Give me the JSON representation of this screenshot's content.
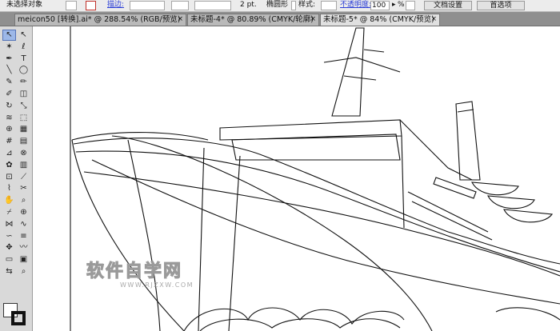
{
  "control_bar": {
    "selection_status": "未选择对象",
    "stroke_label": "描边:",
    "stroke_weight": "2 pt.",
    "brush_label": "椭圆形",
    "style_label": "样式:",
    "opacity_label": "不透明度:",
    "opacity_value": "100",
    "percent_symbol": "%",
    "doc_setup_button": "文档设置",
    "preferences_button": "首选项"
  },
  "tabs": [
    {
      "label": "meicon50 [转换].ai* @ 288.54% (RGB/预览)",
      "close": "×",
      "active": false
    },
    {
      "label": "未标题-4* @ 80.89% (CMYK/轮廓)",
      "close": "×",
      "active": false
    },
    {
      "label": "未标题-5* @ 84% (CMYK/预览)",
      "close": "×",
      "active": true
    }
  ],
  "watermark": {
    "title": "软件自学网",
    "url": "WWW.RJZXW.COM"
  },
  "tools": [
    [
      "selection-tool",
      "↖"
    ],
    [
      "direct-selection-tool",
      "↖"
    ],
    [
      "magic-wand-tool",
      "✶"
    ],
    [
      "lasso-tool",
      "ℓ"
    ],
    [
      "pen-tool",
      "✒"
    ],
    [
      "type-tool",
      "T"
    ],
    [
      "line-tool",
      "╲"
    ],
    [
      "ellipse-tool",
      "◯"
    ],
    [
      "paintbrush-tool",
      "✎"
    ],
    [
      "pencil-tool",
      "✏"
    ],
    [
      "blob-brush-tool",
      "✐"
    ],
    [
      "eraser-tool",
      "◫"
    ],
    [
      "rotate-tool",
      "↻"
    ],
    [
      "scale-tool",
      "⤡"
    ],
    [
      "warp-tool",
      "≋"
    ],
    [
      "free-transform-tool",
      "⬚"
    ],
    [
      "shape-builder-tool",
      "⊕"
    ],
    [
      "perspective-grid-tool",
      "▦"
    ],
    [
      "mesh-tool",
      "#"
    ],
    [
      "gradient-tool",
      "▤"
    ],
    [
      "eyedropper-tool",
      "⊿"
    ],
    [
      "blend-tool",
      "⊗"
    ],
    [
      "symbol-sprayer-tool",
      "✿"
    ],
    [
      "column-graph-tool",
      "▥"
    ],
    [
      "artboard-tool",
      "⊡"
    ],
    [
      "slice-tool",
      "⟋"
    ],
    [
      "width-tool",
      "⌇"
    ],
    [
      "scissors-tool",
      "✂"
    ],
    [
      "hand-tool",
      "✋"
    ],
    [
      "zoom-tool",
      "⌕"
    ],
    [
      "knife-tool",
      "⌿"
    ],
    [
      "crosshair-tool",
      "⊕"
    ],
    [
      "mirror-tool",
      "⋈"
    ],
    [
      "reshape-tool",
      "∿"
    ],
    [
      "curvature-tool",
      "∽"
    ],
    [
      "list-tool",
      "≡"
    ],
    [
      "puppet-warp-tool",
      "✥"
    ],
    [
      "smooth-tool",
      "〰"
    ],
    [
      "screen-mode-tool",
      "▭"
    ],
    [
      "draw-inside-tool",
      "▣"
    ],
    [
      "fill-swap-tool",
      "⇆"
    ],
    [
      "zoom-tool-2",
      "⌕"
    ]
  ]
}
